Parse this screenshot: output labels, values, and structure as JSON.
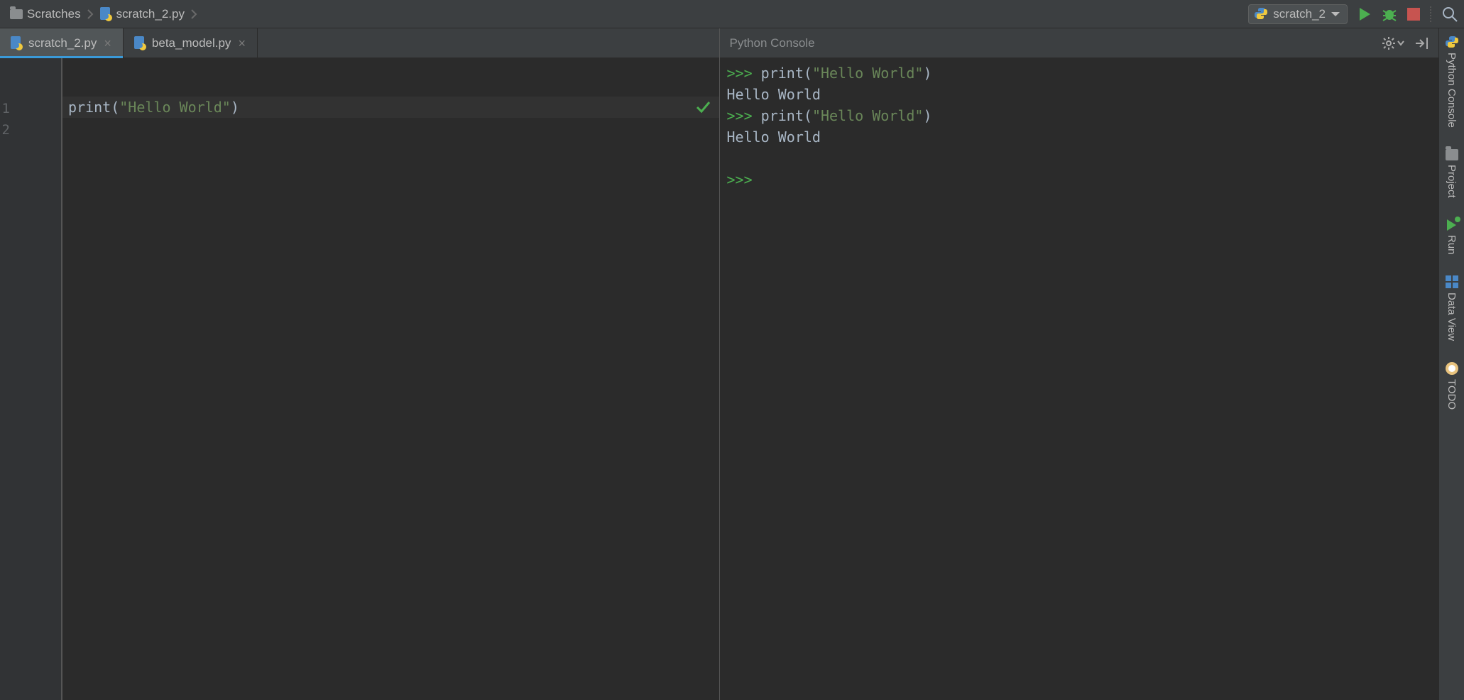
{
  "breadcrumb": {
    "folder": "Scratches",
    "file": "scratch_2.py"
  },
  "toolbar": {
    "run_config": "scratch_2"
  },
  "tabs": [
    {
      "label": "scratch_2.py",
      "active": true
    },
    {
      "label": "beta_model.py",
      "active": false
    }
  ],
  "editor": {
    "lines": [
      "1",
      "2"
    ],
    "code": {
      "fn": "print",
      "open": "(",
      "str": "\"Hello World\"",
      "close": ")"
    }
  },
  "console": {
    "title": "Python Console",
    "lines": [
      {
        "type": "in",
        "prompt": ">>> ",
        "fn": "print",
        "open": "(",
        "str": "\"Hello World\"",
        "close": ")"
      },
      {
        "type": "out",
        "text": "Hello World"
      },
      {
        "type": "in",
        "prompt": ">>> ",
        "fn": "print",
        "open": "(",
        "str": "\"Hello World\"",
        "close": ")"
      },
      {
        "type": "out",
        "text": "Hello World"
      },
      {
        "type": "blank"
      },
      {
        "type": "prompt_only",
        "prompt": ">>> "
      }
    ]
  },
  "rail": {
    "python_console": "Python Console",
    "project": "Project",
    "run": "Run",
    "data_view": "Data View",
    "todo": "TODO"
  }
}
